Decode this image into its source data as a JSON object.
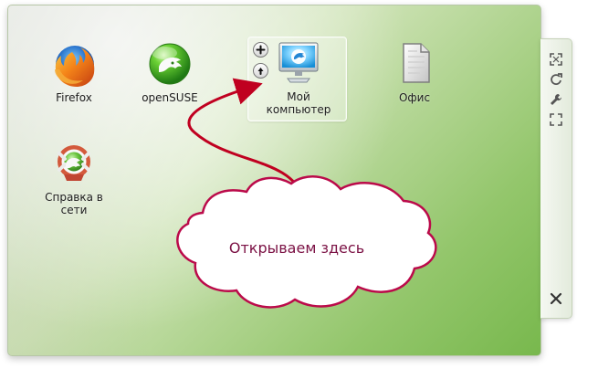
{
  "desktop": {
    "icons": [
      {
        "label": "Firefox",
        "icon": "firefox-icon"
      },
      {
        "label": "openSUSE",
        "icon": "opensuse-icon"
      },
      {
        "label": "Мой компьютер",
        "icon": "computer-monitor-icon"
      },
      {
        "label": "Офис",
        "icon": "office-document-icon"
      },
      {
        "label": "Справка в сети",
        "icon": "online-help-icon"
      }
    ]
  },
  "annotation": {
    "text": "Открываем здесь"
  },
  "panel": {
    "buttons": [
      {
        "icon": "resize-icon"
      },
      {
        "icon": "rotate-icon"
      },
      {
        "icon": "wrench-icon"
      },
      {
        "icon": "expand-icon"
      },
      {
        "icon": "close-icon"
      }
    ]
  },
  "colors": {
    "accent_red": "#c00020",
    "annotation_text": "#7b1144",
    "desktop_green": "#8cc35f"
  }
}
